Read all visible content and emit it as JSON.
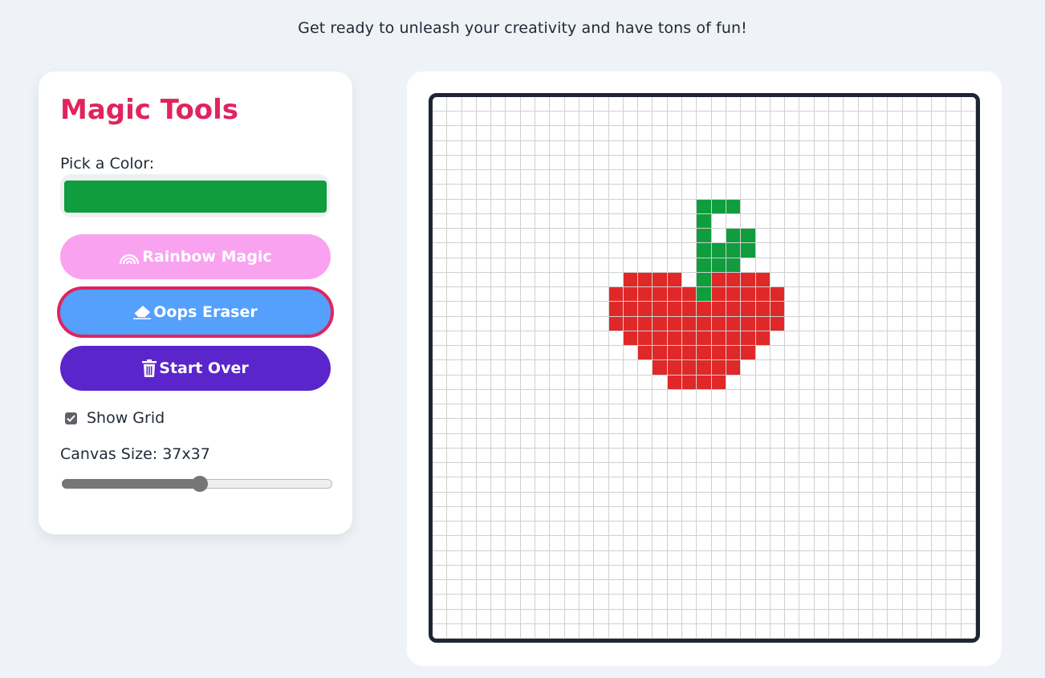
{
  "header": {
    "subtitle": "Get ready to unleash your creativity and have tons of fun!"
  },
  "tools": {
    "title": "Magic Tools",
    "color_label": "Pick a Color:",
    "selected_color": "#0f9d3e",
    "rainbow_label": "Rainbow Magic",
    "rainbow_icon": "rainbow-icon",
    "eraser_label": "Oops Eraser",
    "eraser_icon": "eraser-icon",
    "eraser_active": true,
    "clear_label": "Start Over",
    "clear_icon": "trash-icon",
    "show_grid_label": "Show Grid",
    "show_grid": true,
    "canvas_size_label": "Canvas Size: 37x37",
    "canvas_size": 37,
    "canvas_size_slider_fraction": 0.51
  },
  "colors": {
    "accent": "#e0245e",
    "rainbow_button": "#f9a3f0",
    "eraser_button": "#54a0fc",
    "clear_button": "#5b25cc",
    "red": "#e02828",
    "green": "#0f9d3e",
    "grid_line": "#d0d0d0",
    "frame": "#1e2633"
  },
  "canvas": {
    "size": 37,
    "painted": {
      "green": [
        [
          7,
          18
        ],
        [
          7,
          19
        ],
        [
          7,
          20
        ],
        [
          8,
          18
        ],
        [
          9,
          18
        ],
        [
          9,
          20
        ],
        [
          9,
          21
        ],
        [
          10,
          18
        ],
        [
          10,
          19
        ],
        [
          10,
          20
        ],
        [
          10,
          21
        ],
        [
          11,
          18
        ],
        [
          11,
          19
        ],
        [
          11,
          20
        ],
        [
          12,
          18
        ],
        [
          13,
          18
        ]
      ],
      "red": [
        [
          12,
          13
        ],
        [
          12,
          14
        ],
        [
          12,
          15
        ],
        [
          12,
          16
        ],
        [
          12,
          19
        ],
        [
          12,
          20
        ],
        [
          12,
          21
        ],
        [
          12,
          22
        ],
        [
          13,
          12
        ],
        [
          13,
          13
        ],
        [
          13,
          14
        ],
        [
          13,
          15
        ],
        [
          13,
          16
        ],
        [
          13,
          17
        ],
        [
          13,
          19
        ],
        [
          13,
          20
        ],
        [
          13,
          21
        ],
        [
          13,
          22
        ],
        [
          13,
          23
        ],
        [
          14,
          12
        ],
        [
          14,
          13
        ],
        [
          14,
          14
        ],
        [
          14,
          15
        ],
        [
          14,
          16
        ],
        [
          14,
          17
        ],
        [
          14,
          18
        ],
        [
          14,
          19
        ],
        [
          14,
          20
        ],
        [
          14,
          21
        ],
        [
          14,
          22
        ],
        [
          14,
          23
        ],
        [
          15,
          12
        ],
        [
          15,
          13
        ],
        [
          15,
          14
        ],
        [
          15,
          15
        ],
        [
          15,
          16
        ],
        [
          15,
          17
        ],
        [
          15,
          18
        ],
        [
          15,
          19
        ],
        [
          15,
          20
        ],
        [
          15,
          21
        ],
        [
          15,
          22
        ],
        [
          15,
          23
        ],
        [
          16,
          13
        ],
        [
          16,
          14
        ],
        [
          16,
          15
        ],
        [
          16,
          16
        ],
        [
          16,
          17
        ],
        [
          16,
          18
        ],
        [
          16,
          19
        ],
        [
          16,
          20
        ],
        [
          16,
          21
        ],
        [
          16,
          22
        ],
        [
          17,
          14
        ],
        [
          17,
          15
        ],
        [
          17,
          16
        ],
        [
          17,
          17
        ],
        [
          17,
          18
        ],
        [
          17,
          19
        ],
        [
          17,
          20
        ],
        [
          17,
          21
        ],
        [
          18,
          15
        ],
        [
          18,
          16
        ],
        [
          18,
          17
        ],
        [
          18,
          18
        ],
        [
          18,
          19
        ],
        [
          18,
          20
        ],
        [
          19,
          16
        ],
        [
          19,
          17
        ],
        [
          19,
          18
        ],
        [
          19,
          19
        ]
      ]
    }
  }
}
